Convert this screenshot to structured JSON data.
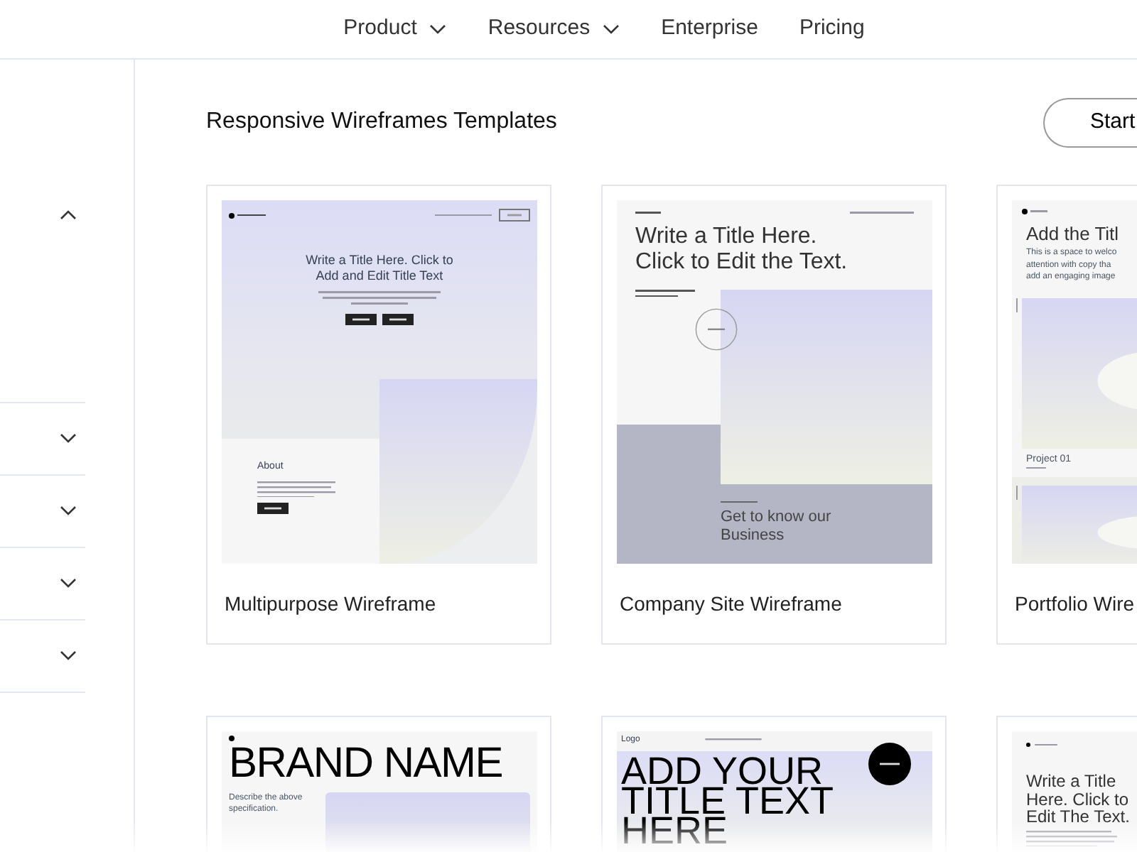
{
  "nav": [
    {
      "label": "Product",
      "dropdown": true
    },
    {
      "label": "Resources",
      "dropdown": true
    },
    {
      "label": "Enterprise",
      "dropdown": false
    },
    {
      "label": "Pricing",
      "dropdown": false
    }
  ],
  "sidebar": {
    "sections": [
      {
        "expanded": true
      },
      {
        "expanded": false
      },
      {
        "expanded": false
      },
      {
        "expanded": false
      },
      {
        "expanded": false
      }
    ]
  },
  "heading": "Responsive Wireframes Templates",
  "start_button": "Start",
  "templates": [
    {
      "title": "Multipurpose Wireframe",
      "thumbnail": {
        "kind": "multipurpose",
        "headline": "Write a Title Here. Click to Add and Edit Title Text",
        "about_title": "About"
      }
    },
    {
      "title": "Company Site Wireframe",
      "thumbnail": {
        "kind": "company",
        "headline": "Write a Title Here. Click to Edit the Text.",
        "subhead": "Get to know our Business"
      }
    },
    {
      "title": "Portfolio Wire",
      "thumbnail": {
        "kind": "portfolio",
        "headline": "Add the Titl",
        "intro_lines": [
          "This is a space to welco",
          "attention with copy tha",
          "add an engaging image"
        ],
        "project": "Project 01"
      }
    },
    {
      "thumbnail": {
        "kind": "brand",
        "headline": "BRAND NAME",
        "caption": "Describe the above specification."
      }
    },
    {
      "thumbnail": {
        "kind": "service",
        "brand": "Logo",
        "headline": "ADD YOUR TITLE TEXT HERE"
      }
    },
    {
      "thumbnail": {
        "kind": "minimal",
        "headline": "Write a Title Here. Click to Edit The Text."
      }
    }
  ]
}
